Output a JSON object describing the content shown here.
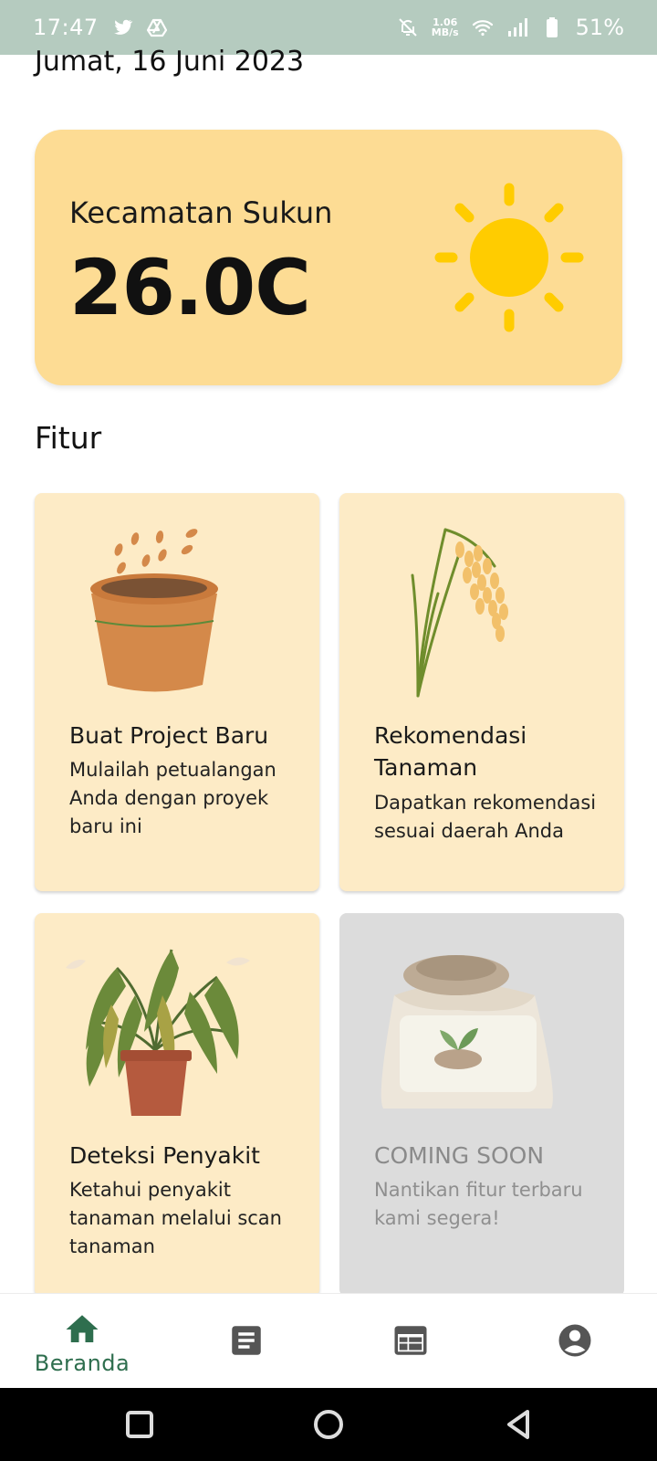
{
  "status_bar": {
    "time": "17:47",
    "net_speed_value": "1.06",
    "net_speed_unit": "MB/s",
    "battery": "51%",
    "icons": [
      "twitter-icon",
      "drive-icon",
      "mute-icon",
      "wifi-icon",
      "signal-icon",
      "battery-icon"
    ]
  },
  "header": {
    "date": "Jumat, 16 Juni 2023"
  },
  "weather": {
    "location": "Kecamatan Sukun",
    "temperature": "26.0C",
    "icon": "sun-icon",
    "card_color": "#fddc94",
    "sun_color": "#ffcc00"
  },
  "features": {
    "title": "Fitur",
    "cards": [
      {
        "title": "Buat Project Baru",
        "description": "Mulailah petualangan Anda dengan proyek baru ini",
        "icon": "flower-pot-icon"
      },
      {
        "title": "Rekomendasi Tanaman",
        "description": "Dapatkan rekomendasi sesuai daerah Anda",
        "icon": "rice-plant-icon"
      },
      {
        "title": "Deteksi Penyakit",
        "description": "Ketahui penyakit tanaman melalui scan tanaman",
        "icon": "wilted-plant-icon"
      },
      {
        "title": "COMING SOON",
        "description": "Nantikan fitur terbaru kami segera!",
        "icon": "fertilizer-sack-icon"
      }
    ],
    "card_color": "#fdebc6"
  },
  "bottom_nav": {
    "items": [
      {
        "label": "Beranda",
        "icon": "home-icon",
        "active": true
      },
      {
        "label": "",
        "icon": "article-icon"
      },
      {
        "label": "",
        "icon": "calendar-icon"
      },
      {
        "label": "",
        "icon": "account-icon"
      }
    ],
    "active_color": "#2e6e4e",
    "inactive_color": "#555555"
  },
  "system_nav": {
    "icons": [
      "recents-icon",
      "home-circle-icon",
      "back-icon"
    ]
  }
}
